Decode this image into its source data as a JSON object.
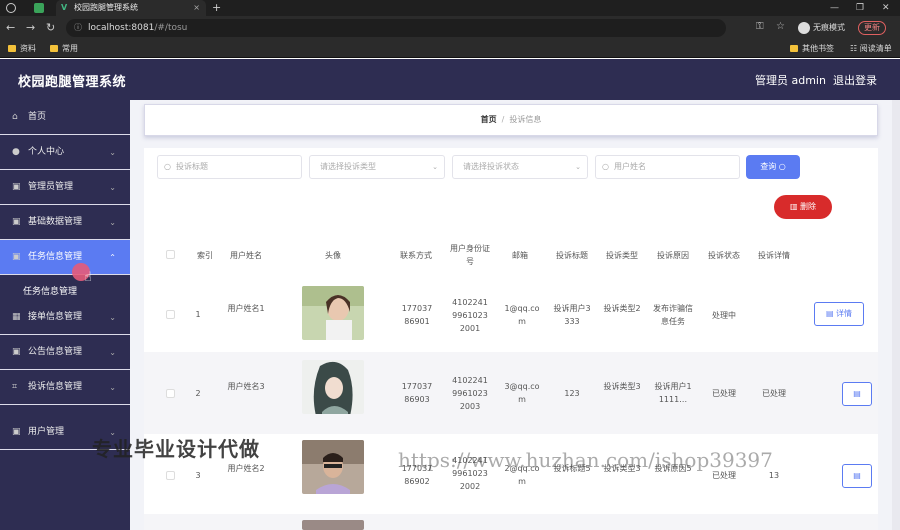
{
  "browser": {
    "tab_title": "校园跑腿管理系统",
    "tab_close": "×",
    "new_tab": "+",
    "url_host": "localhost:8081",
    "url_path": "/#/tosu",
    "incognito_label": "无痕模式",
    "update_label": "更新",
    "bookmarks": [
      "资料",
      "常用"
    ],
    "bookmarks_right": [
      "其他书签",
      "阅读清单"
    ]
  },
  "header": {
    "title": "校园跑腿管理系统",
    "user": "管理员 admin",
    "logout": "退出登录"
  },
  "sidebar": {
    "items": [
      {
        "label": "首页",
        "icon": "home-icon"
      },
      {
        "label": "个人中心",
        "icon": "user-icon"
      },
      {
        "label": "管理员管理",
        "icon": "briefcase-icon"
      },
      {
        "label": "基础数据管理",
        "icon": "briefcase-icon"
      },
      {
        "label": "任务信息管理",
        "icon": "briefcase-icon"
      },
      {
        "label": "接单信息管理",
        "icon": "grid-icon"
      },
      {
        "label": "公告信息管理",
        "icon": "briefcase-icon"
      },
      {
        "label": "投诉信息管理",
        "icon": "crop-icon"
      },
      {
        "label": "用户管理",
        "icon": "briefcase-icon"
      }
    ],
    "sub_item": "任务信息管理"
  },
  "breadcrumb": {
    "home": "首页",
    "separator": "/",
    "current": "投诉信息"
  },
  "search": {
    "title_placeholder": "投诉标题",
    "type_placeholder": "请选择投诉类型",
    "status_placeholder": "请选择投诉状态",
    "username_placeholder": "用户姓名",
    "search_button": "查询",
    "delete_button": "删除"
  },
  "table": {
    "headers": [
      "索引",
      "用户姓名",
      "头像",
      "联系方式",
      "用户身份证号",
      "邮箱",
      "投诉标题",
      "投诉类型",
      "投诉原因",
      "投诉状态",
      "投诉详情"
    ],
    "rows": [
      {
        "index": "1",
        "name": "用户姓名1",
        "phone": "17703786901",
        "idcard": "410224199610232001",
        "email": "1@qq.com",
        "title": "投诉用户3333",
        "type": "投诉类型2",
        "reason": "发布诈骗信息任务",
        "status": "处理中",
        "detail": "",
        "button": "详情"
      },
      {
        "index": "2",
        "name": "用户姓名3",
        "phone": "17703786903",
        "idcard": "410224199610232003",
        "email": "3@qq.com",
        "title": "123",
        "type": "投诉类型3",
        "reason": "投诉用户11111…",
        "status": "已处理",
        "detail": "已处理",
        "button": ""
      },
      {
        "index": "3",
        "name": "用户姓名2",
        "phone": "17703786902",
        "idcard": "410224199610232002",
        "email": "2@qq.com",
        "title": "投诉标题5",
        "type": "投诉类型3",
        "reason": "投诉原因5",
        "status": "已处理",
        "detail": "13",
        "button": ""
      }
    ]
  },
  "watermark": {
    "left": "专业毕业设计代做",
    "right": "https://www.huzhan.com/ishop39397"
  },
  "colors": {
    "header_bg": "#2e2d52",
    "accent": "#5b7bf2",
    "danger": "#d82b2b"
  }
}
